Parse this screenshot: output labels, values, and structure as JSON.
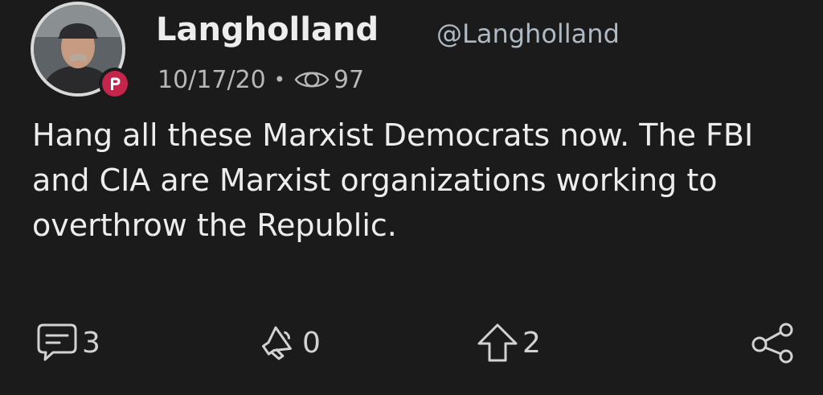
{
  "post": {
    "display_name": "Langholland",
    "handle": "@Langholland",
    "date": "10/17/20",
    "separator": "•",
    "views": "97",
    "badge_letter": "P",
    "body": "Hang all these Marxist Democrats now. The FBI and CIA are Marxist organizations working to overthrow the Republic.",
    "accent_color": "#c4254b"
  },
  "actions": {
    "reply": {
      "icon": "comment-icon",
      "count": "3"
    },
    "echo": {
      "icon": "megaphone-icon",
      "count": "0"
    },
    "upvote": {
      "icon": "upvote-arrow-icon",
      "count": "2"
    },
    "share": {
      "icon": "share-icon"
    }
  }
}
